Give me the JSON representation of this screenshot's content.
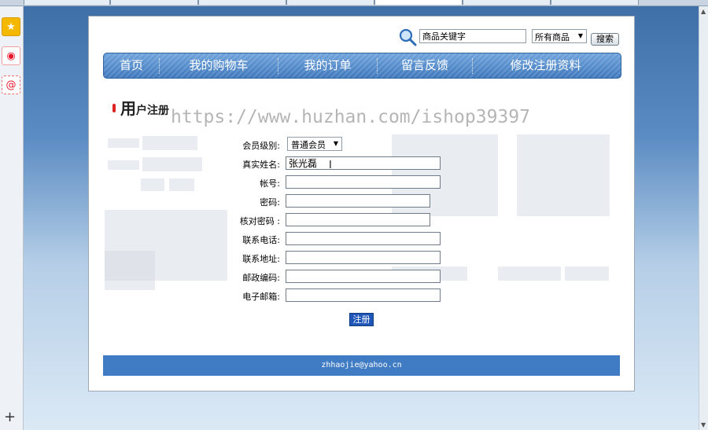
{
  "search": {
    "placeholder": "商品关键字",
    "scope": "所有商品",
    "button_label": "搜索"
  },
  "nav": {
    "items": [
      {
        "label": "首页"
      },
      {
        "label": "我的购物车"
      },
      {
        "label": "我的订单"
      },
      {
        "label": "留言反馈"
      },
      {
        "label": "修改注册资料"
      }
    ]
  },
  "page": {
    "title_big": "用",
    "title_rest": "户注册"
  },
  "watermark": "https://www.huzhan.com/ishop39397",
  "form": {
    "level_label": "会员级别:",
    "level_value": "普通会员",
    "realname_label": "真实姓名:",
    "realname_value": "张光磊",
    "account_label": "帐号:",
    "password_label": "密码:",
    "confirm_label": "核对密码 :",
    "phone_label": "联系电话:",
    "address_label": "联系地址:",
    "postcode_label": "邮政编码:",
    "email_label": "电子邮箱:",
    "submit_label": "注册"
  },
  "footer": {
    "email": "zhhaojie@yahoo.cn"
  },
  "colors": {
    "nav_bg": "#3f78bd",
    "footer_bg": "#3f7cc4",
    "submit_bg": "#1f56b8",
    "title_marker": "#dd2222"
  },
  "icons": {
    "search": "magnifier-icon",
    "bookmark": "star-icon",
    "weibo": "weibo-icon",
    "mail": "mail-icon"
  }
}
